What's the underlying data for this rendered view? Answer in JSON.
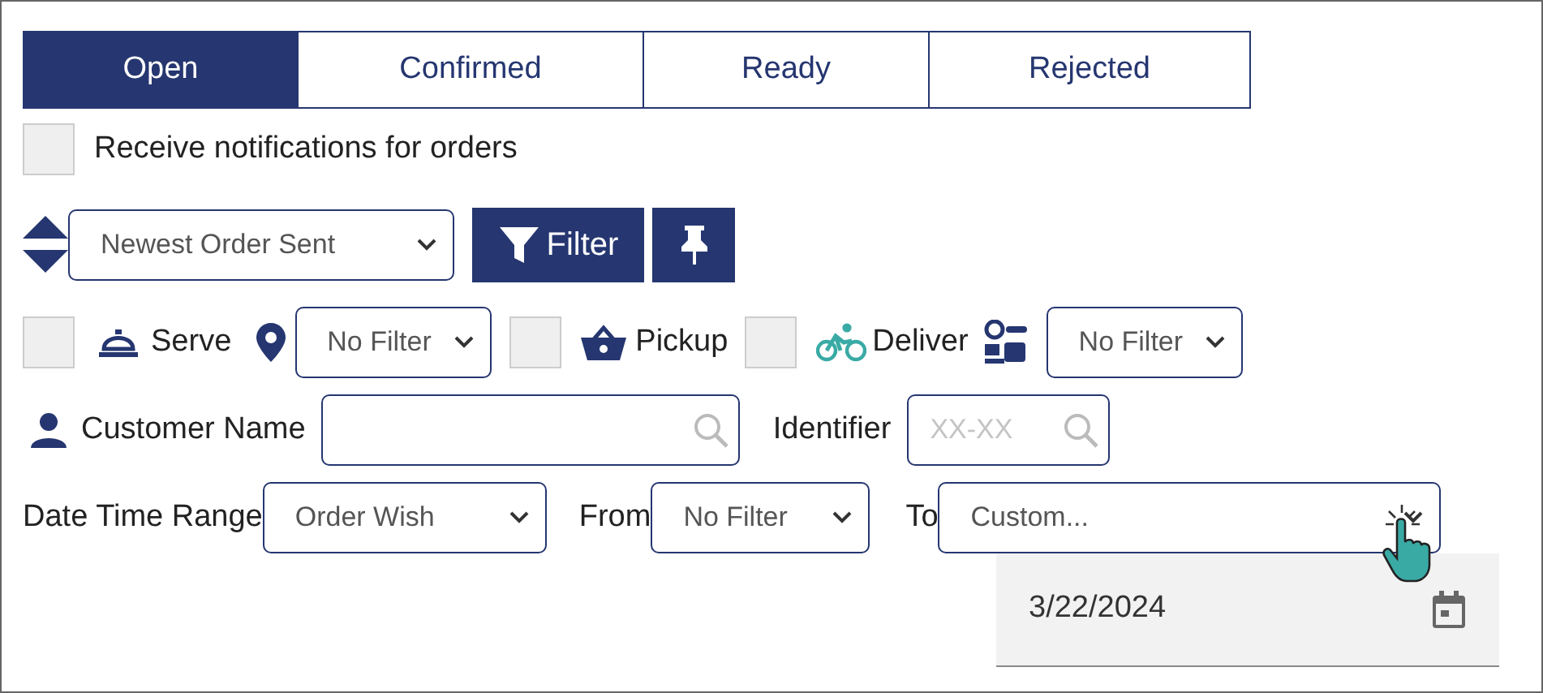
{
  "tabs": [
    {
      "label": "Open",
      "selected": true
    },
    {
      "label": "Confirmed",
      "selected": false
    },
    {
      "label": "Ready",
      "selected": false
    },
    {
      "label": "Rejected",
      "selected": false
    }
  ],
  "notifications": {
    "label": "Receive notifications for orders",
    "checked": false
  },
  "sort": {
    "value": "Newest Order Sent"
  },
  "filter_button": {
    "label": "Filter"
  },
  "service_filters": [
    {
      "kind": "checkbox",
      "checked": false
    },
    {
      "kind": "label",
      "label": "Serve"
    },
    {
      "kind": "select",
      "value": "No Filter"
    },
    {
      "kind": "checkbox",
      "checked": false
    },
    {
      "kind": "label",
      "label": "Pickup"
    },
    {
      "kind": "checkbox",
      "checked": false
    },
    {
      "kind": "label",
      "label": "Deliver"
    },
    {
      "kind": "select",
      "value": "No Filter"
    }
  ],
  "customer_name": {
    "label": "Customer Name"
  },
  "identifier": {
    "label": "Identifier",
    "placeholder": "XX-XX"
  },
  "date_range": {
    "label": "Date Time Range",
    "value": "Order Wish"
  },
  "from": {
    "label": "From",
    "value": "No Filter"
  },
  "to": {
    "label": "To",
    "value": "Custom..."
  },
  "date_input": {
    "value": "3/22/2024"
  }
}
